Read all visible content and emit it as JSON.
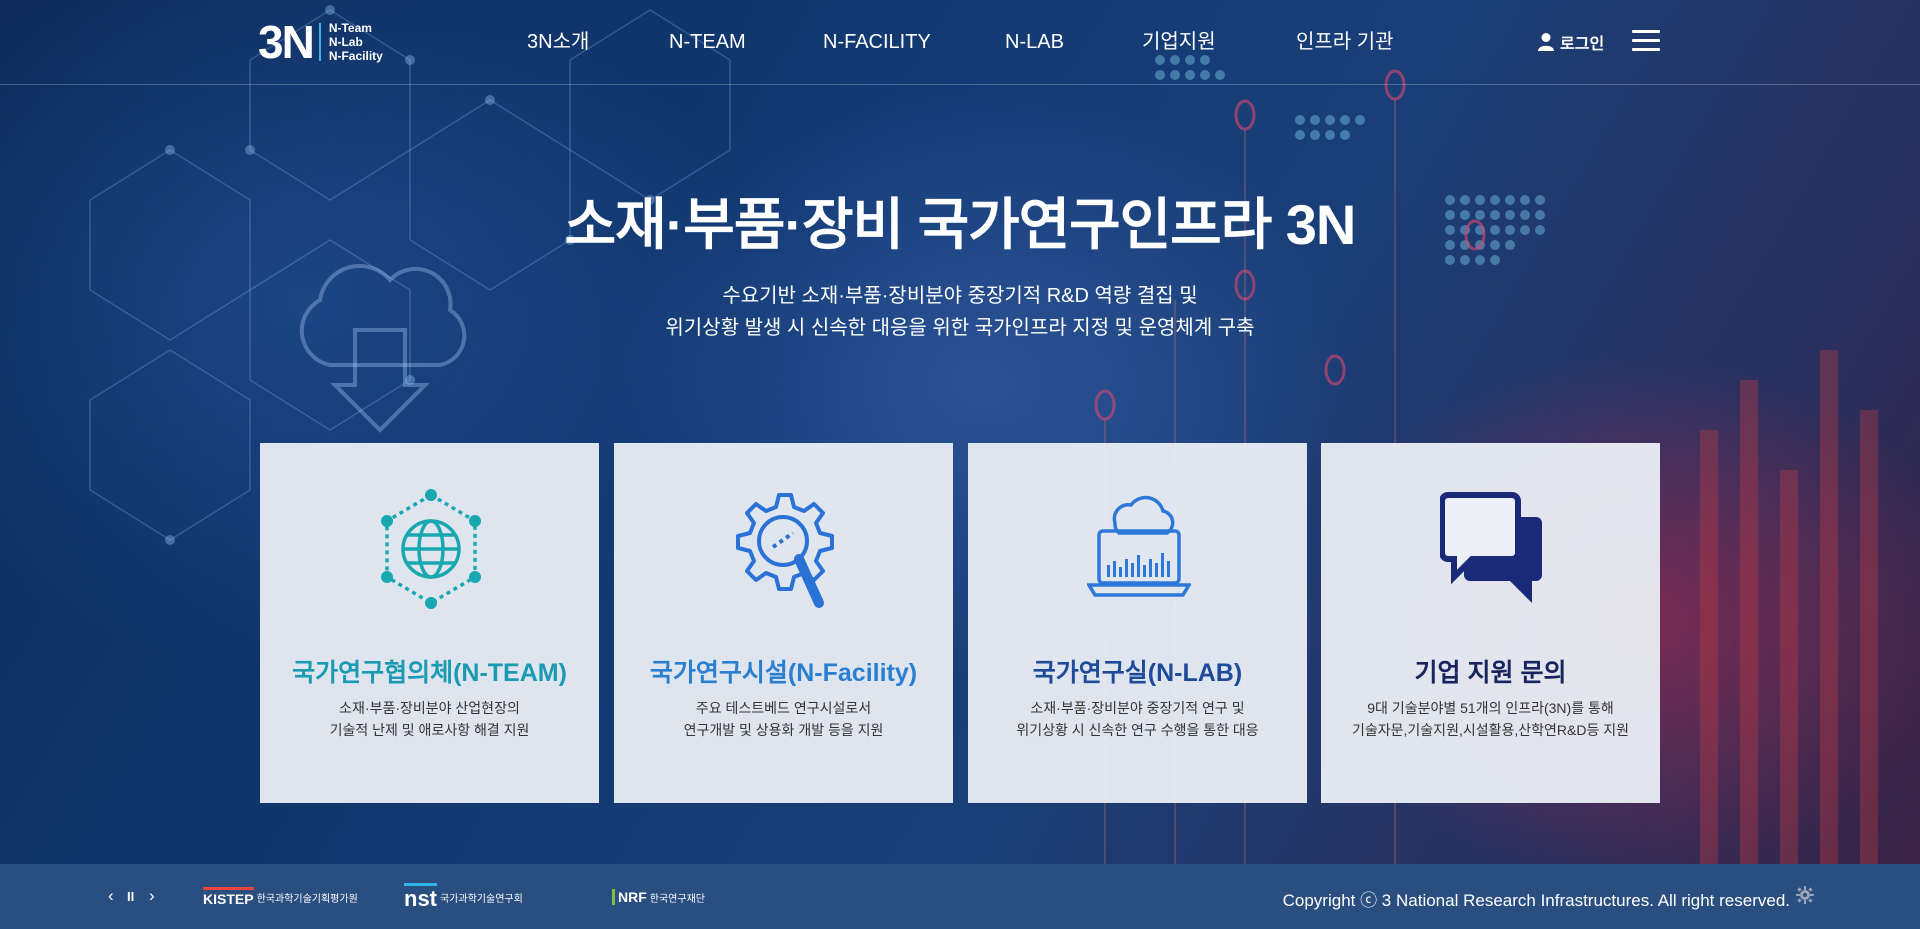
{
  "header": {
    "logo": {
      "mark": "3N",
      "lines": [
        "N-Team",
        "N-Lab",
        "N-Facility"
      ]
    },
    "nav": [
      "3N소개",
      "N-TEAM",
      "N-FACILITY",
      "N-LAB",
      "기업지원",
      "인프라 기관"
    ],
    "login_label": "로그인",
    "menu_icon": "hamburger-menu-icon"
  },
  "hero": {
    "title": "소재·부품·장비 국가연구인프라 3N",
    "subtitle_line1": "수요기반 소재·부품·장비분야 중장기적 R&D 역량 결집 및",
    "subtitle_line2": "위기상황 발생 시 신속한 대응을 위한 국가인프라 지정 및 운영체계 구축"
  },
  "cards": [
    {
      "icon": "network-globe-icon",
      "title": "국가연구협의체(N-TEAM)",
      "title_color": "#1a9bb3",
      "desc_line1": "소재·부품·장비분야 산업현장의",
      "desc_line2": "기술적 난제 및 애로사항 해결 지원"
    },
    {
      "icon": "gear-magnifier-icon",
      "title": "국가연구시설(N-Facility)",
      "title_color": "#2a7fd1",
      "desc_line1": "주요 테스트베드 연구시설로서",
      "desc_line2": "연구개발 및 상용화 개발 등을 지원"
    },
    {
      "icon": "cloud-laptop-icon",
      "title": "국가연구실(N-LAB)",
      "title_color": "#1f4a9a",
      "desc_line1": "소재·부품·장비분야 중장기적 연구 및",
      "desc_line2": "위기상황 시 신속한 연구 수행을 통한 대응"
    },
    {
      "icon": "chat-bubbles-icon",
      "title": "기업 지원 문의",
      "title_color": "#17245e",
      "desc_line1": "9대 기술분야별 51개의 인프라(3N)를 통해",
      "desc_line2": "기술자문,기술지원,시설활용,산학연R&D등 지원"
    }
  ],
  "footer": {
    "controls": {
      "prev": "‹",
      "pause": "II",
      "next": "›"
    },
    "partners": [
      {
        "mark": "KISTEP",
        "name": "한국과학기술기획평가원",
        "color": "#e8453c"
      },
      {
        "mark": "nst",
        "name": "국가과학기술연구회",
        "color": "#2fb5e8"
      },
      {
        "mark": "NRF",
        "name": "한국연구재단",
        "color": "#7bc142"
      }
    ],
    "copyright": "Copyright ⓒ 3 National Research Infrastructures. All right reserved.",
    "settings_icon": "gear-icon"
  }
}
